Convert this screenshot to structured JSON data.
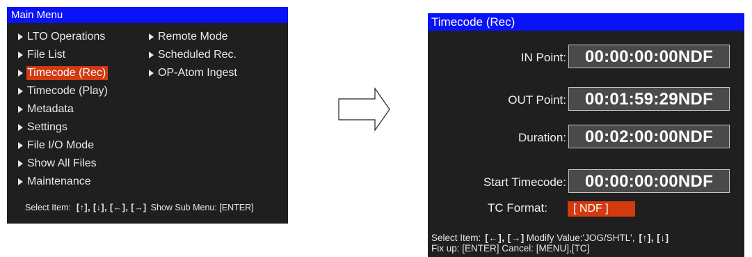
{
  "main_menu": {
    "title": "Main Menu",
    "column1": [
      "LTO Operations",
      "File List",
      "Timecode (Rec)",
      "Timecode (Play)",
      "Metadata",
      "Settings",
      "File I/O Mode",
      "Show All Files",
      "Maintenance"
    ],
    "column2": [
      "Remote Mode",
      "Scheduled Rec.",
      "OP-Atom Ingest"
    ],
    "selected_item": "Timecode (Rec)",
    "footer": {
      "select_label": "Select Item:",
      "select_keys": "[↑], [↓], [←], [→]",
      "submenu_label": "Show Sub Menu: [ENTER]"
    }
  },
  "timecode_rec": {
    "title": "Timecode (Rec)",
    "in_point": {
      "label": "IN Point:",
      "value": "00:00:00:00NDF"
    },
    "out_point": {
      "label": "OUT Point:",
      "value": "00:01:59:29NDF"
    },
    "duration": {
      "label": "Duration:",
      "value": "00:02:00:00NDF"
    },
    "start_timecode": {
      "label": "Start Timecode:",
      "value": "00:00:00:00NDF"
    },
    "tc_format": {
      "label": "TC Format:",
      "value": "[ NDF ]"
    },
    "footer": {
      "line1_label": "Select Item:",
      "line1_keys": "[←], [→]",
      "line1_modify": "Modify Value:'JOG/SHTL',",
      "line1_keys2": "[↑], [↓]",
      "line2": "Fix up: [ENTER]  Cancel: [MENU],[TC]"
    }
  },
  "colors": {
    "title_bar": "#0a12f6",
    "panel_bg": "#1f1f1f",
    "highlight": "#d33a10",
    "field_bg": "#4a4a4a"
  }
}
